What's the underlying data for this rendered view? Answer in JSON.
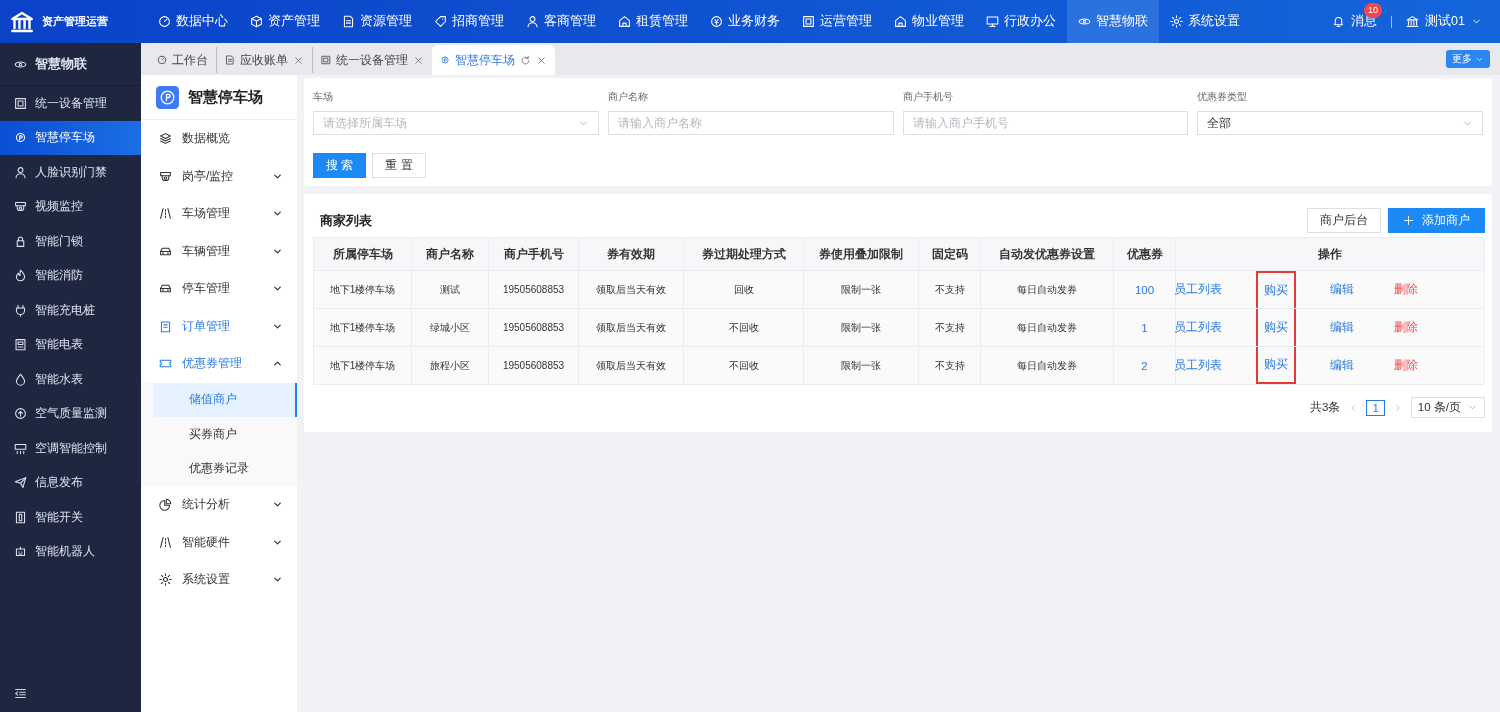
{
  "brand": {
    "title": "资产管理运营"
  },
  "top_nav": [
    {
      "label": "数据中心",
      "selected": false
    },
    {
      "label": "资产管理",
      "selected": false
    },
    {
      "label": "资源管理",
      "selected": false
    },
    {
      "label": "招商管理",
      "selected": false
    },
    {
      "label": "客商管理",
      "selected": false
    },
    {
      "label": "租赁管理",
      "selected": false
    },
    {
      "label": "业务财务",
      "selected": false
    },
    {
      "label": "运营管理",
      "selected": false
    },
    {
      "label": "物业管理",
      "selected": false
    },
    {
      "label": "行政办公",
      "selected": false
    },
    {
      "label": "智慧物联",
      "selected": true
    },
    {
      "label": "系统设置",
      "selected": false
    }
  ],
  "messages": {
    "label": "消息",
    "badge": "10"
  },
  "user": {
    "name": "测试01"
  },
  "sidebar": {
    "title": "智慧物联",
    "items": [
      {
        "label": "统一设备管理",
        "selected": false
      },
      {
        "label": "智慧停车场",
        "selected": true
      },
      {
        "label": "人脸识别门禁",
        "selected": false
      },
      {
        "label": "视频监控",
        "selected": false
      },
      {
        "label": "智能门锁",
        "selected": false
      },
      {
        "label": "智能消防",
        "selected": false
      },
      {
        "label": "智能充电桩",
        "selected": false
      },
      {
        "label": "智能电表",
        "selected": false
      },
      {
        "label": "智能水表",
        "selected": false
      },
      {
        "label": "空气质量监测",
        "selected": false
      },
      {
        "label": "空调智能控制",
        "selected": false
      },
      {
        "label": "信息发布",
        "selected": false
      },
      {
        "label": "智能开关",
        "selected": false
      },
      {
        "label": "智能机器人",
        "selected": false
      }
    ]
  },
  "tabs": [
    {
      "label": "工作台",
      "selected": false,
      "closable": false
    },
    {
      "label": "应收账单",
      "selected": false,
      "closable": true
    },
    {
      "label": "统一设备管理",
      "selected": false,
      "closable": true
    },
    {
      "label": "智慧停车场",
      "selected": true,
      "closable": true
    }
  ],
  "more_button": "更多",
  "submenu": {
    "title": "智慧停车场",
    "items": [
      {
        "label": "数据概览",
        "active": false
      },
      {
        "label": "岗亭/监控",
        "active": false,
        "expandable": true,
        "expanded": false
      },
      {
        "label": "车场管理",
        "active": false,
        "expandable": true,
        "expanded": false
      },
      {
        "label": "车辆管理",
        "active": false,
        "expandable": true,
        "expanded": false
      },
      {
        "label": "停车管理",
        "active": false,
        "expandable": true,
        "expanded": false
      },
      {
        "label": "订单管理",
        "active": true,
        "expandable": true,
        "expanded": false
      },
      {
        "label": "优惠券管理",
        "active": true,
        "expandable": true,
        "expanded": true,
        "children": [
          {
            "label": "储值商户",
            "selected": true
          },
          {
            "label": "买券商户",
            "selected": false
          },
          {
            "label": "优惠券记录",
            "selected": false
          }
        ]
      },
      {
        "label": "统计分析",
        "active": false,
        "expandable": true,
        "expanded": false
      },
      {
        "label": "智能硬件",
        "active": false,
        "expandable": true,
        "expanded": false
      },
      {
        "label": "系统设置",
        "active": false,
        "expandable": true,
        "expanded": false
      }
    ]
  },
  "filters": [
    {
      "label": "车场",
      "kind": "select",
      "placeholder": "请选择所属车场"
    },
    {
      "label": "商户名称",
      "kind": "input",
      "placeholder": "请输入商户名称"
    },
    {
      "label": "商户手机号",
      "kind": "input",
      "placeholder": "请输入商户手机号"
    },
    {
      "label": "优惠券类型",
      "kind": "select",
      "value": "全部"
    }
  ],
  "filter_buttons": {
    "search": "搜 索",
    "reset": "重 置"
  },
  "table": {
    "title": "商家列表",
    "buttons": {
      "merchant_backend": "商户后台",
      "add": "添加商户"
    },
    "columns": [
      {
        "label": "所属停车场",
        "kind": "text"
      },
      {
        "label": "商户名称",
        "kind": "text"
      },
      {
        "label": "商户手机号",
        "kind": "text"
      },
      {
        "label": "券有效期",
        "kind": "text"
      },
      {
        "label": "券过期处理方式",
        "kind": "text"
      },
      {
        "label": "券使用叠加限制",
        "kind": "text"
      },
      {
        "label": "固定码",
        "kind": "text"
      },
      {
        "label": "自动发优惠券设置",
        "kind": "text"
      },
      {
        "label": "优惠券",
        "kind": "link"
      },
      {
        "label": "操作",
        "kind": "actions"
      }
    ],
    "rows": [
      {
        "cells": [
          "地下1楼停车场",
          "测试",
          "19505608853",
          "领取后当天有效",
          "回收",
          "限制一张",
          "不支持",
          "每日自动发券",
          "100"
        ],
        "actions": [
          {
            "label": "员工列表",
            "kind": "link",
            "highlighted": false
          },
          {
            "label": "购买",
            "kind": "link",
            "highlighted": true
          },
          {
            "label": "编辑",
            "kind": "link",
            "highlighted": false
          },
          {
            "label": "删除",
            "kind": "danger",
            "highlighted": false
          }
        ]
      },
      {
        "cells": [
          "地下1楼停车场",
          "绿城小区",
          "19505608853",
          "领取后当天有效",
          "不回收",
          "限制一张",
          "不支持",
          "每日自动发券",
          "1"
        ],
        "actions": [
          {
            "label": "员工列表",
            "kind": "link",
            "highlighted": false
          },
          {
            "label": "购买",
            "kind": "link",
            "highlighted": true
          },
          {
            "label": "编辑",
            "kind": "link",
            "highlighted": false
          },
          {
            "label": "删除",
            "kind": "danger",
            "highlighted": false
          }
        ]
      },
      {
        "cells": [
          "地下1楼停车场",
          "旅程小区",
          "19505608853",
          "领取后当天有效",
          "不回收",
          "限制一张",
          "不支持",
          "每日自动发券",
          "2"
        ],
        "actions": [
          {
            "label": "员工列表",
            "kind": "link",
            "highlighted": false
          },
          {
            "label": "购买",
            "kind": "link",
            "highlighted": true
          },
          {
            "label": "编辑",
            "kind": "link",
            "highlighted": false
          },
          {
            "label": "删除",
            "kind": "danger",
            "highlighted": false
          }
        ]
      }
    ]
  },
  "pagination": {
    "total": "共3条",
    "pages": [
      {
        "label": "1",
        "selected": true
      }
    ],
    "page_size": "10 条/页"
  }
}
